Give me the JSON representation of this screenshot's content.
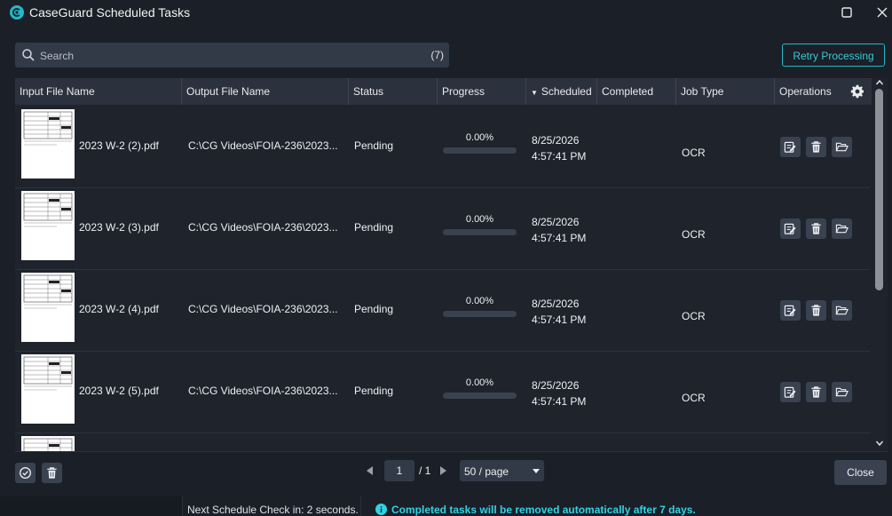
{
  "window": {
    "title": "CaseGuard Scheduled Tasks"
  },
  "search": {
    "placeholder": "Search",
    "count": "(7)"
  },
  "toolbar": {
    "retry_label": "Retry Processing"
  },
  "table": {
    "columns": [
      "Input File Name",
      "Output File Name",
      "Status",
      "Progress",
      "Scheduled",
      "Completed",
      "Job Type",
      "Operations"
    ],
    "sorted_column": "Scheduled",
    "rows": [
      {
        "input": "2023 W-2 (2).pdf",
        "output": "C:\\CG Videos\\FOIA-236\\2023...",
        "status": "Pending",
        "progress_label": "0.00%",
        "progress": 0,
        "date": "8/25/2026",
        "time": "4:57:41 PM",
        "completed": "",
        "job_type": "OCR"
      },
      {
        "input": "2023 W-2 (3).pdf",
        "output": "C:\\CG Videos\\FOIA-236\\2023...",
        "status": "Pending",
        "progress_label": "0.00%",
        "progress": 0,
        "date": "8/25/2026",
        "time": "4:57:41 PM",
        "completed": "",
        "job_type": "OCR"
      },
      {
        "input": "2023 W-2 (4).pdf",
        "output": "C:\\CG Videos\\FOIA-236\\2023...",
        "status": "Pending",
        "progress_label": "0.00%",
        "progress": 0,
        "date": "8/25/2026",
        "time": "4:57:41 PM",
        "completed": "",
        "job_type": "OCR"
      },
      {
        "input": "2023 W-2 (5).pdf",
        "output": "C:\\CG Videos\\FOIA-236\\2023...",
        "status": "Pending",
        "progress_label": "0.00%",
        "progress": 0,
        "date": "8/25/2026",
        "time": "4:57:41 PM",
        "completed": "",
        "job_type": "OCR"
      },
      {
        "input": "",
        "output": "",
        "status": "",
        "progress_label": "",
        "progress": 0,
        "date": "",
        "time": "",
        "completed": "",
        "job_type": ""
      }
    ]
  },
  "pagination": {
    "current_page": "1",
    "total": "/ 1",
    "per_page": "50 / page"
  },
  "footer": {
    "close_label": "Close"
  },
  "statusbar": {
    "schedule_check": "Next Schedule Check in: 2 seconds.",
    "info": "Completed tasks will be removed automatically after 7 days."
  },
  "colors": {
    "accent": "#23b9c9",
    "background": "#1b1f27",
    "header": "#2b323d"
  },
  "icons": [
    "caseguard-logo-icon",
    "maximize-icon",
    "close-icon",
    "search-icon",
    "gear-icon",
    "edit-icon",
    "trash-icon",
    "folder-open-icon",
    "check-circle-icon",
    "chevron-left-icon",
    "chevron-right-icon",
    "info-icon"
  ]
}
